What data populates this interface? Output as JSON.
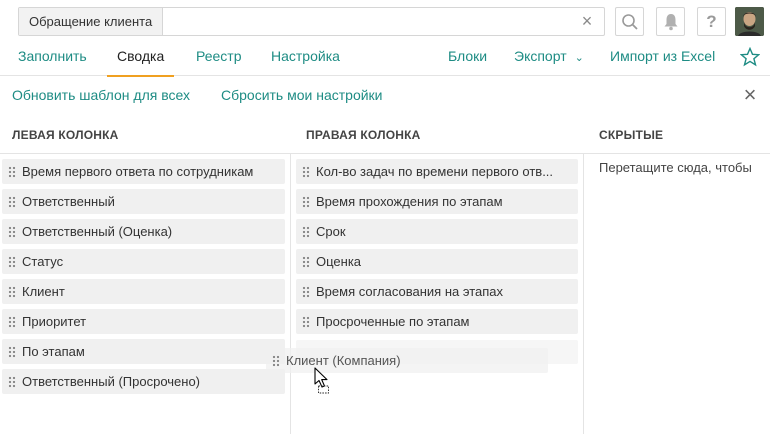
{
  "search": {
    "tag": "Обращение клиента",
    "value": "",
    "clear_icon": "close-icon"
  },
  "toolbar": {
    "search_icon": "search-icon",
    "bell_icon": "bell-icon",
    "help_label": "?",
    "avatar_icon": "user-avatar"
  },
  "tabs": [
    {
      "label": "Заполнить"
    },
    {
      "label": "Сводка",
      "active": true
    },
    {
      "label": "Реестр"
    },
    {
      "label": "Настройка"
    }
  ],
  "right_tabs": [
    {
      "label": "Блоки"
    },
    {
      "label": "Экспорт"
    },
    {
      "label": "Импорт из Excel"
    }
  ],
  "actions": {
    "update_template": "Обновить шаблон для всех",
    "reset_settings": "Сбросить мои настройки"
  },
  "columns": {
    "left": {
      "title": "ЛЕВАЯ КОЛОНКА",
      "items": [
        "Время первого ответа по сотрудникам",
        "Ответственный",
        "Ответственный (Оценка)",
        "Статус",
        "Клиент",
        "Приоритет",
        "По этапам",
        "Ответственный (Просрочено)"
      ]
    },
    "right": {
      "title": "ПРАВАЯ КОЛОНКА",
      "items": [
        "Кол-во задач по времени первого отв...",
        "Время прохождения по этапам",
        "Срок",
        "Оценка",
        "Время согласования на этапах",
        "Просроченные по этапам"
      ]
    },
    "hidden": {
      "title": "СКРЫТЫЕ",
      "hint": "Перетащите сюда, чтобы"
    }
  },
  "dragging_item": "Клиент (Компания)",
  "colors": {
    "accent": "#1e8c84",
    "active_tab_underline": "#f0a020",
    "item_bg": "#f0f0f0"
  }
}
